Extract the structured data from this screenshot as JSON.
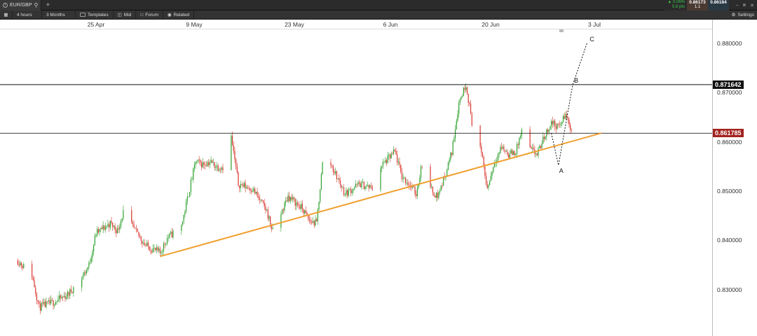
{
  "window": {
    "tab_label": "EUR/GBP",
    "tab_info_icon": "info-icon",
    "tab_search_icon": "search-icon",
    "add_tab_icon": "plus-icon"
  },
  "quote": {
    "change_pct": "▲ 0.06%",
    "change_pips": "5.6 pts",
    "sell_price": "0.86173",
    "spread": "1.1",
    "buy_price": "0.86184"
  },
  "toolbar": {
    "timeframe": "4 hours",
    "range": "3 Months",
    "templates": "Templates",
    "price_type": "Mid",
    "forum": "Forum",
    "related": "Related",
    "settings": "Settings"
  },
  "x_axis": [
    "25 Apr",
    "9 May",
    "23 May",
    "6 Jun",
    "20 Jun",
    "3 Jul"
  ],
  "y_axis": [
    "0.880000",
    "0.870000",
    "0.860000",
    "0.850000",
    "0.840000",
    "0.830000"
  ],
  "price_marks": {
    "resistance": "0.871642",
    "current": "0.861785"
  },
  "wave_labels": [
    "A",
    "B",
    "C"
  ],
  "colors": {
    "bull": "#2ca02c",
    "bear": "#d9362e",
    "trendline": "#f0a030",
    "current_price": "#a3231f"
  },
  "chart_data": {
    "type": "candlestick",
    "instrument": "EUR/GBP",
    "timeframe": "4 hours",
    "ylim": [
      0.823,
      0.884
    ],
    "horizontal_lines": [
      0.871642,
      0.861785
    ],
    "trendline": [
      {
        "date": "2017-05-04",
        "price": 0.8368
      },
      {
        "date": "2017-07-05",
        "price": 0.8618
      }
    ],
    "projection": [
      {
        "label": "",
        "date": "2017-06-28",
        "price": 0.8618
      },
      {
        "label": "A",
        "date": "2017-06-29",
        "price": 0.8553
      },
      {
        "label": "B",
        "date": "2017-07-01",
        "price": 0.8716
      },
      {
        "label": "C",
        "date": "2017-07-03",
        "price": 0.88
      }
    ],
    "path": [
      [
        "2017-04-14",
        0.836
      ],
      [
        "2017-04-16",
        0.833
      ],
      [
        "2017-04-17",
        0.8265
      ],
      [
        "2017-04-19",
        0.8275
      ],
      [
        "2017-04-21",
        0.829
      ],
      [
        "2017-04-23",
        0.8325
      ],
      [
        "2017-04-24",
        0.835
      ],
      [
        "2017-04-25",
        0.8415
      ],
      [
        "2017-04-27",
        0.8435
      ],
      [
        "2017-04-28",
        0.842
      ],
      [
        "2017-04-29",
        0.8465
      ],
      [
        "2017-04-30",
        0.843
      ],
      [
        "2017-05-02",
        0.839
      ],
      [
        "2017-05-04",
        0.8375
      ],
      [
        "2017-05-05",
        0.8405
      ],
      [
        "2017-05-07",
        0.843
      ],
      [
        "2017-05-08",
        0.8495
      ],
      [
        "2017-05-09",
        0.856
      ],
      [
        "2017-05-10",
        0.8555
      ],
      [
        "2017-05-11",
        0.856
      ],
      [
        "2017-05-12",
        0.855
      ],
      [
        "2017-05-13",
        0.855
      ],
      [
        "2017-05-14",
        0.861
      ],
      [
        "2017-05-15",
        0.8515
      ],
      [
        "2017-05-17",
        0.8505
      ],
      [
        "2017-05-19",
        0.846
      ],
      [
        "2017-05-20",
        0.841
      ],
      [
        "2017-05-21",
        0.8455
      ],
      [
        "2017-05-22",
        0.849
      ],
      [
        "2017-05-24",
        0.8465
      ],
      [
        "2017-05-25",
        0.844
      ],
      [
        "2017-05-26",
        0.8435
      ],
      [
        "2017-05-27",
        0.858
      ],
      [
        "2017-05-28",
        0.8555
      ],
      [
        "2017-05-30",
        0.8495
      ],
      [
        "2017-06-01",
        0.8515
      ],
      [
        "2017-06-03",
        0.8505
      ],
      [
        "2017-06-04",
        0.855
      ],
      [
        "2017-06-06",
        0.858
      ],
      [
        "2017-06-07",
        0.853
      ],
      [
        "2017-06-08",
        0.8515
      ],
      [
        "2017-06-09",
        0.8495
      ],
      [
        "2017-06-10",
        0.857
      ],
      [
        "2017-06-11",
        0.8505
      ],
      [
        "2017-06-12",
        0.849
      ],
      [
        "2017-06-13",
        0.853
      ],
      [
        "2017-06-14",
        0.858
      ],
      [
        "2017-06-15",
        0.868
      ],
      [
        "2017-06-16",
        0.8718
      ],
      [
        "2017-06-17",
        0.8625
      ],
      [
        "2017-06-18",
        0.859
      ],
      [
        "2017-06-19",
        0.8505
      ],
      [
        "2017-06-20",
        0.856
      ],
      [
        "2017-06-21",
        0.859
      ],
      [
        "2017-06-22",
        0.8575
      ],
      [
        "2017-06-23",
        0.858
      ],
      [
        "2017-06-24",
        0.863
      ],
      [
        "2017-06-25",
        0.8585
      ],
      [
        "2017-06-26",
        0.8575
      ],
      [
        "2017-06-27",
        0.861
      ],
      [
        "2017-06-28",
        0.864
      ],
      [
        "2017-06-29",
        0.863
      ],
      [
        "2017-06-30",
        0.8655
      ],
      [
        "2017-07-01",
        0.8618
      ]
    ]
  }
}
